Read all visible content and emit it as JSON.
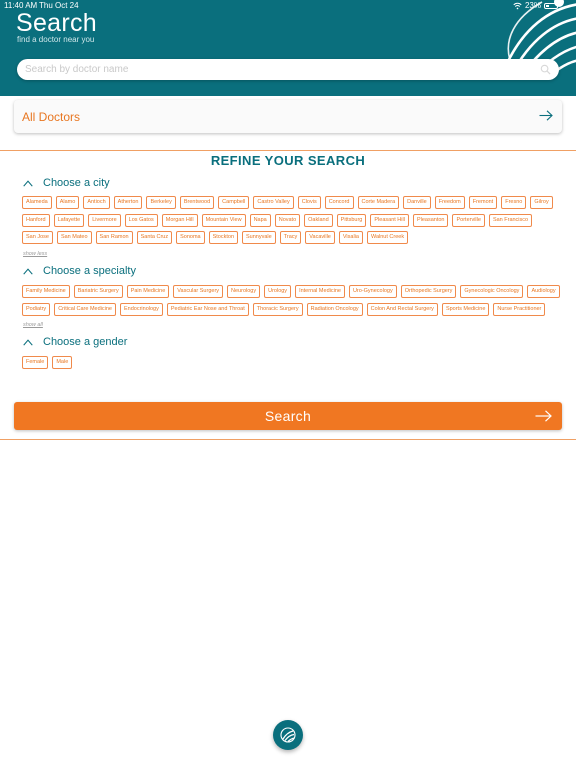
{
  "status": {
    "time": "11:40 AM",
    "date": "Thu Oct 24",
    "battery": "23%"
  },
  "header": {
    "title": "Search",
    "subtitle": "find a doctor near you"
  },
  "search": {
    "placeholder": "Search by doctor name"
  },
  "all_doctors": {
    "label": "All Doctors"
  },
  "refine": {
    "title": "REFINE YOUR SEARCH"
  },
  "city": {
    "label": "Choose a city",
    "rows": [
      [
        "Alameda",
        "Alamo",
        "Antioch",
        "Atherton",
        "Berkeley",
        "Brentwood",
        "Campbell",
        "Castro Valley",
        "Clovis",
        "Concord",
        "Corte Madera",
        "Danville",
        "Freedom",
        "Fremont",
        "Fresno",
        "Gilroy"
      ],
      [
        "Hanford",
        "Lafayette",
        "Livermore",
        "Los Gatos",
        "Morgan Hill",
        "Mountain View",
        "Napa",
        "Novato",
        "Oakland",
        "Pittsburg",
        "Pleasant Hill",
        "Pleasanton",
        "Porterville",
        "San Francisco"
      ],
      [
        "San Jose",
        "San Mateo",
        "San Ramon",
        "Santa Cruz",
        "Sonoma",
        "Stockton",
        "Sunnyvale",
        "Tracy",
        "Vacaville",
        "Visalia",
        "Walnut Creek"
      ]
    ],
    "toggle": "show less"
  },
  "specialty": {
    "label": "Choose a specialty",
    "rows": [
      [
        "Family Medicine",
        "Bariatric Surgery",
        "Pain Medicine",
        "Vascular Surgery",
        "Neurology",
        "Urology",
        "Internal Medicine",
        "Uro-Gynecology",
        "Orthopedic Surgery",
        "Gynecologic Oncology",
        "Audiology"
      ],
      [
        "Podiatry",
        "Critical Care Medicine",
        "Endocrinology",
        "Pediatric Ear Nose and Throat",
        "Thoracic Surgery",
        "Radiation Oncology",
        "Colon And Rectal Surgery",
        "Sports Medicine",
        "Nurse Practitioner"
      ]
    ],
    "toggle": "show all"
  },
  "gender": {
    "label": "Choose a gender",
    "rows": [
      [
        "Female",
        "Male"
      ]
    ]
  },
  "search_button": {
    "label": "Search"
  },
  "colors": {
    "teal": "#0a6f7d",
    "orange": "#f07722",
    "chip_border": "#f08a4b"
  },
  "icons": [
    "wifi-icon",
    "battery-icon",
    "brand-logo",
    "search-icon",
    "arrow-right-icon",
    "chevron-up-icon"
  ]
}
